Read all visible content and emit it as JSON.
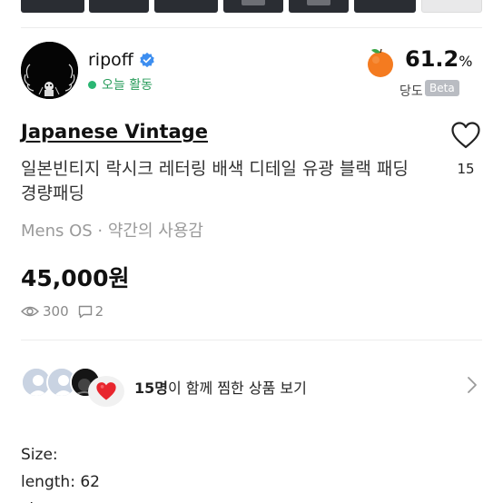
{
  "thumbnails": [
    {
      "theme": "dark"
    },
    {
      "theme": "dark"
    },
    {
      "theme": "dark"
    },
    {
      "theme": "dark"
    },
    {
      "theme": "dark"
    },
    {
      "theme": "dark"
    },
    {
      "theme": "light"
    }
  ],
  "seller": {
    "name": "ripoff",
    "verified_icon": "verified-check-icon",
    "status": "오늘 활동",
    "status_color": "#2bb673"
  },
  "sweetness": {
    "icon": "orange-icon",
    "percent": "61.2",
    "percent_sign": "%",
    "label": "당도",
    "badge": "Beta"
  },
  "product": {
    "brand": "Japanese Vintage",
    "title": "일본빈티지 락시크 레터링 배색 디테일 유광 블랙 패딩 경량패딩",
    "meta": "Mens OS · 약간의 사용감",
    "price": "45,000원",
    "views": "300",
    "chats": "2",
    "likes": "15"
  },
  "liked_by": {
    "count": "15명",
    "text": "이 함께 찜한 상품 보기"
  },
  "description": {
    "line1": "Size:",
    "line2": "length: 62",
    "line3": "chest:"
  }
}
